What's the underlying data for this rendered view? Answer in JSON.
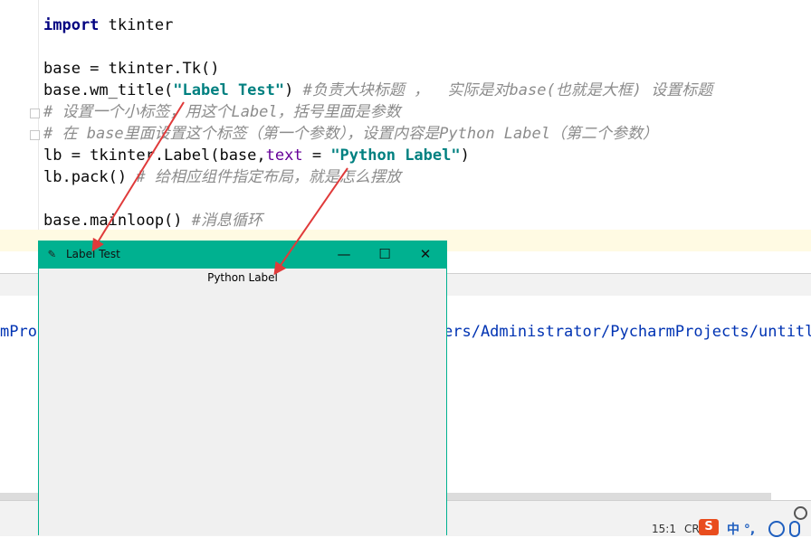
{
  "editor": {
    "lines": [
      {
        "parts": [
          {
            "t": "import",
            "c": "kw"
          },
          {
            "t": " tkinter",
            "c": ""
          }
        ]
      },
      {
        "parts": []
      },
      {
        "parts": [
          {
            "t": "base = tkinter.Tk()",
            "c": ""
          }
        ]
      },
      {
        "parts": [
          {
            "t": "base.wm_title(",
            "c": ""
          },
          {
            "t": "\"Label Test\"",
            "c": "str"
          },
          {
            "t": ") ",
            "c": ""
          },
          {
            "t": "#负责大块标题 ，  实际是对base(也就是大框) 设置标题",
            "c": "cmt"
          }
        ]
      },
      {
        "parts": [
          {
            "t": "# 设置一个小标签，用这个Label，括号里面是参数",
            "c": "cmt"
          }
        ]
      },
      {
        "parts": [
          {
            "t": "# 在 base里面设置这个标签（第一个参数），设置内容是Python Label（第二个参数）",
            "c": "cmt"
          }
        ]
      },
      {
        "parts": [
          {
            "t": "lb = tkinter.Label(base,",
            "c": ""
          },
          {
            "t": "text",
            "c": "param"
          },
          {
            "t": " = ",
            "c": ""
          },
          {
            "t": "\"Python Label\"",
            "c": "str"
          },
          {
            "t": ")",
            "c": ""
          }
        ]
      },
      {
        "parts": [
          {
            "t": "lb.pack() ",
            "c": ""
          },
          {
            "t": "# 给相应组件指定布局，就是怎么摆放",
            "c": "cmt"
          }
        ]
      },
      {
        "parts": []
      },
      {
        "parts": [
          {
            "t": "base.mainloop() ",
            "c": ""
          },
          {
            "t": "#消息循环",
            "c": "cmt"
          }
        ]
      }
    ]
  },
  "run": {
    "left_text": "mProj",
    "path_text": "ers/Administrator/PycharmProjects/untitl"
  },
  "tk_window": {
    "title": "Label Test",
    "label": "Python Label",
    "feather_icon": "✎",
    "minimize": "—",
    "maximize": "☐",
    "close": "✕"
  },
  "statusbar": {
    "position": "15:1",
    "line_sep": "CR",
    "ime_logo": "S",
    "ime_lang": "中 °,"
  },
  "colors": {
    "titlebar": "#00b190",
    "string": "#008080",
    "comment": "#8c8c8c",
    "arrow": "#e03a3a"
  }
}
